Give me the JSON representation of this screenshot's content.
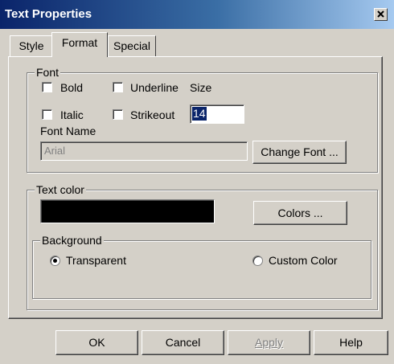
{
  "window": {
    "title": "Text Properties",
    "close_glyph": "×"
  },
  "tabs": [
    {
      "label": "Style"
    },
    {
      "label": "Format",
      "active": true
    },
    {
      "label": "Special"
    }
  ],
  "font_group": {
    "legend": "Font",
    "bold_label": "Bold",
    "bold_checked": false,
    "underline_label": "Underline",
    "underline_checked": false,
    "italic_label": "Italic",
    "italic_checked": false,
    "strikeout_label": "Strikeout",
    "strikeout_checked": false,
    "size_label": "Size",
    "size_value": "14",
    "font_name_label": "Font Name",
    "font_name_value": "Arial",
    "change_font_label": "Change Font ..."
  },
  "text_color_group": {
    "legend": "Text color",
    "swatch_color": "#000000",
    "colors_button_label": "Colors ..."
  },
  "background_group": {
    "legend": "Background",
    "transparent_label": "Transparent",
    "transparent_selected": true,
    "custom_color_label": "Custom Color",
    "custom_color_selected": false
  },
  "footer": {
    "ok_label": "OK",
    "cancel_label": "Cancel",
    "apply_label": "Apply",
    "apply_enabled": false,
    "help_label": "Help"
  },
  "colors": {
    "face": "#d4d0c8",
    "title_dark": "#0a246a",
    "title_light": "#a6caf0",
    "selection": "#0a246a"
  }
}
